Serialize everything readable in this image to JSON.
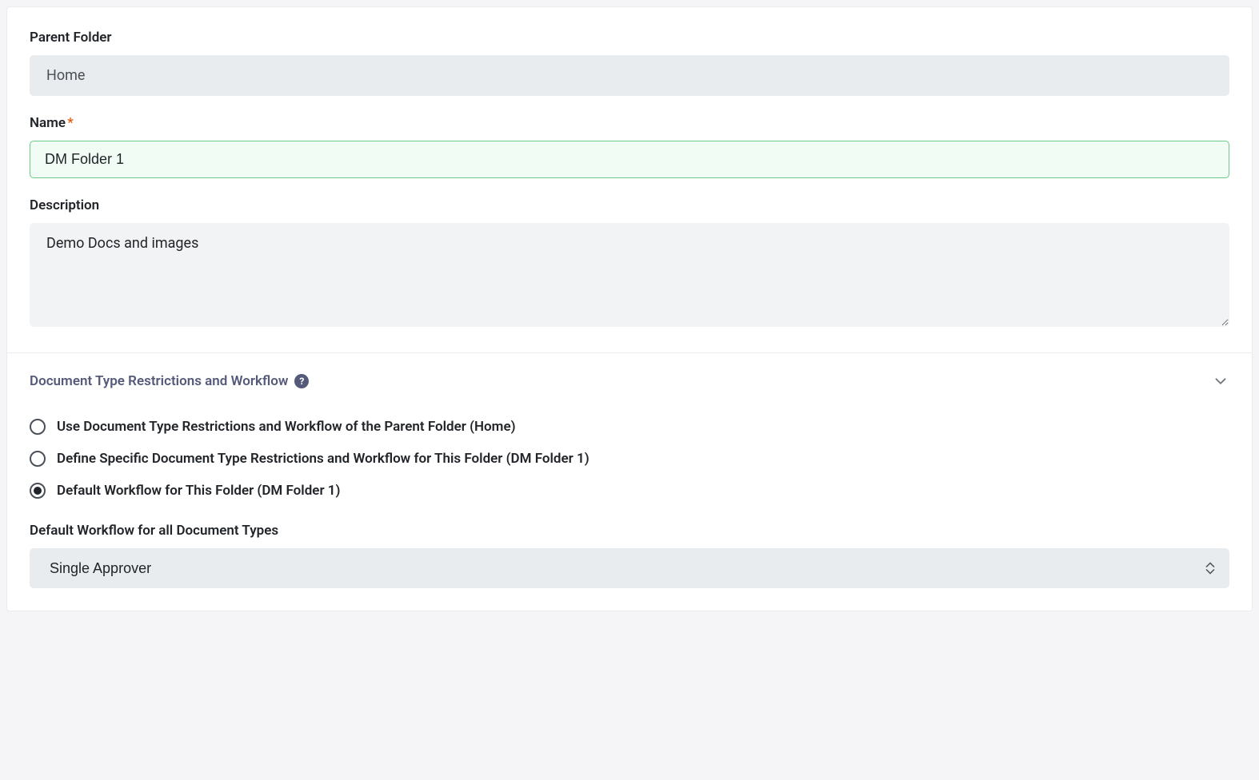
{
  "form": {
    "parentFolder": {
      "label": "Parent Folder",
      "value": "Home"
    },
    "name": {
      "label": "Name",
      "required": "*",
      "value": "DM Folder 1"
    },
    "description": {
      "label": "Description",
      "value": "Demo Docs and images"
    }
  },
  "workflow": {
    "sectionTitle": "Document Type Restrictions and Workflow",
    "helpGlyph": "?",
    "options": [
      {
        "label": "Use Document Type Restrictions and Workflow of the Parent Folder (Home)",
        "checked": false
      },
      {
        "label": "Define Specific Document Type Restrictions and Workflow for This Folder (DM Folder 1)",
        "checked": false
      },
      {
        "label": "Default Workflow for This Folder (DM Folder 1)",
        "checked": true
      }
    ],
    "defaultWorkflow": {
      "label": "Default Workflow for all Document Types",
      "selected": "Single Approver"
    }
  }
}
